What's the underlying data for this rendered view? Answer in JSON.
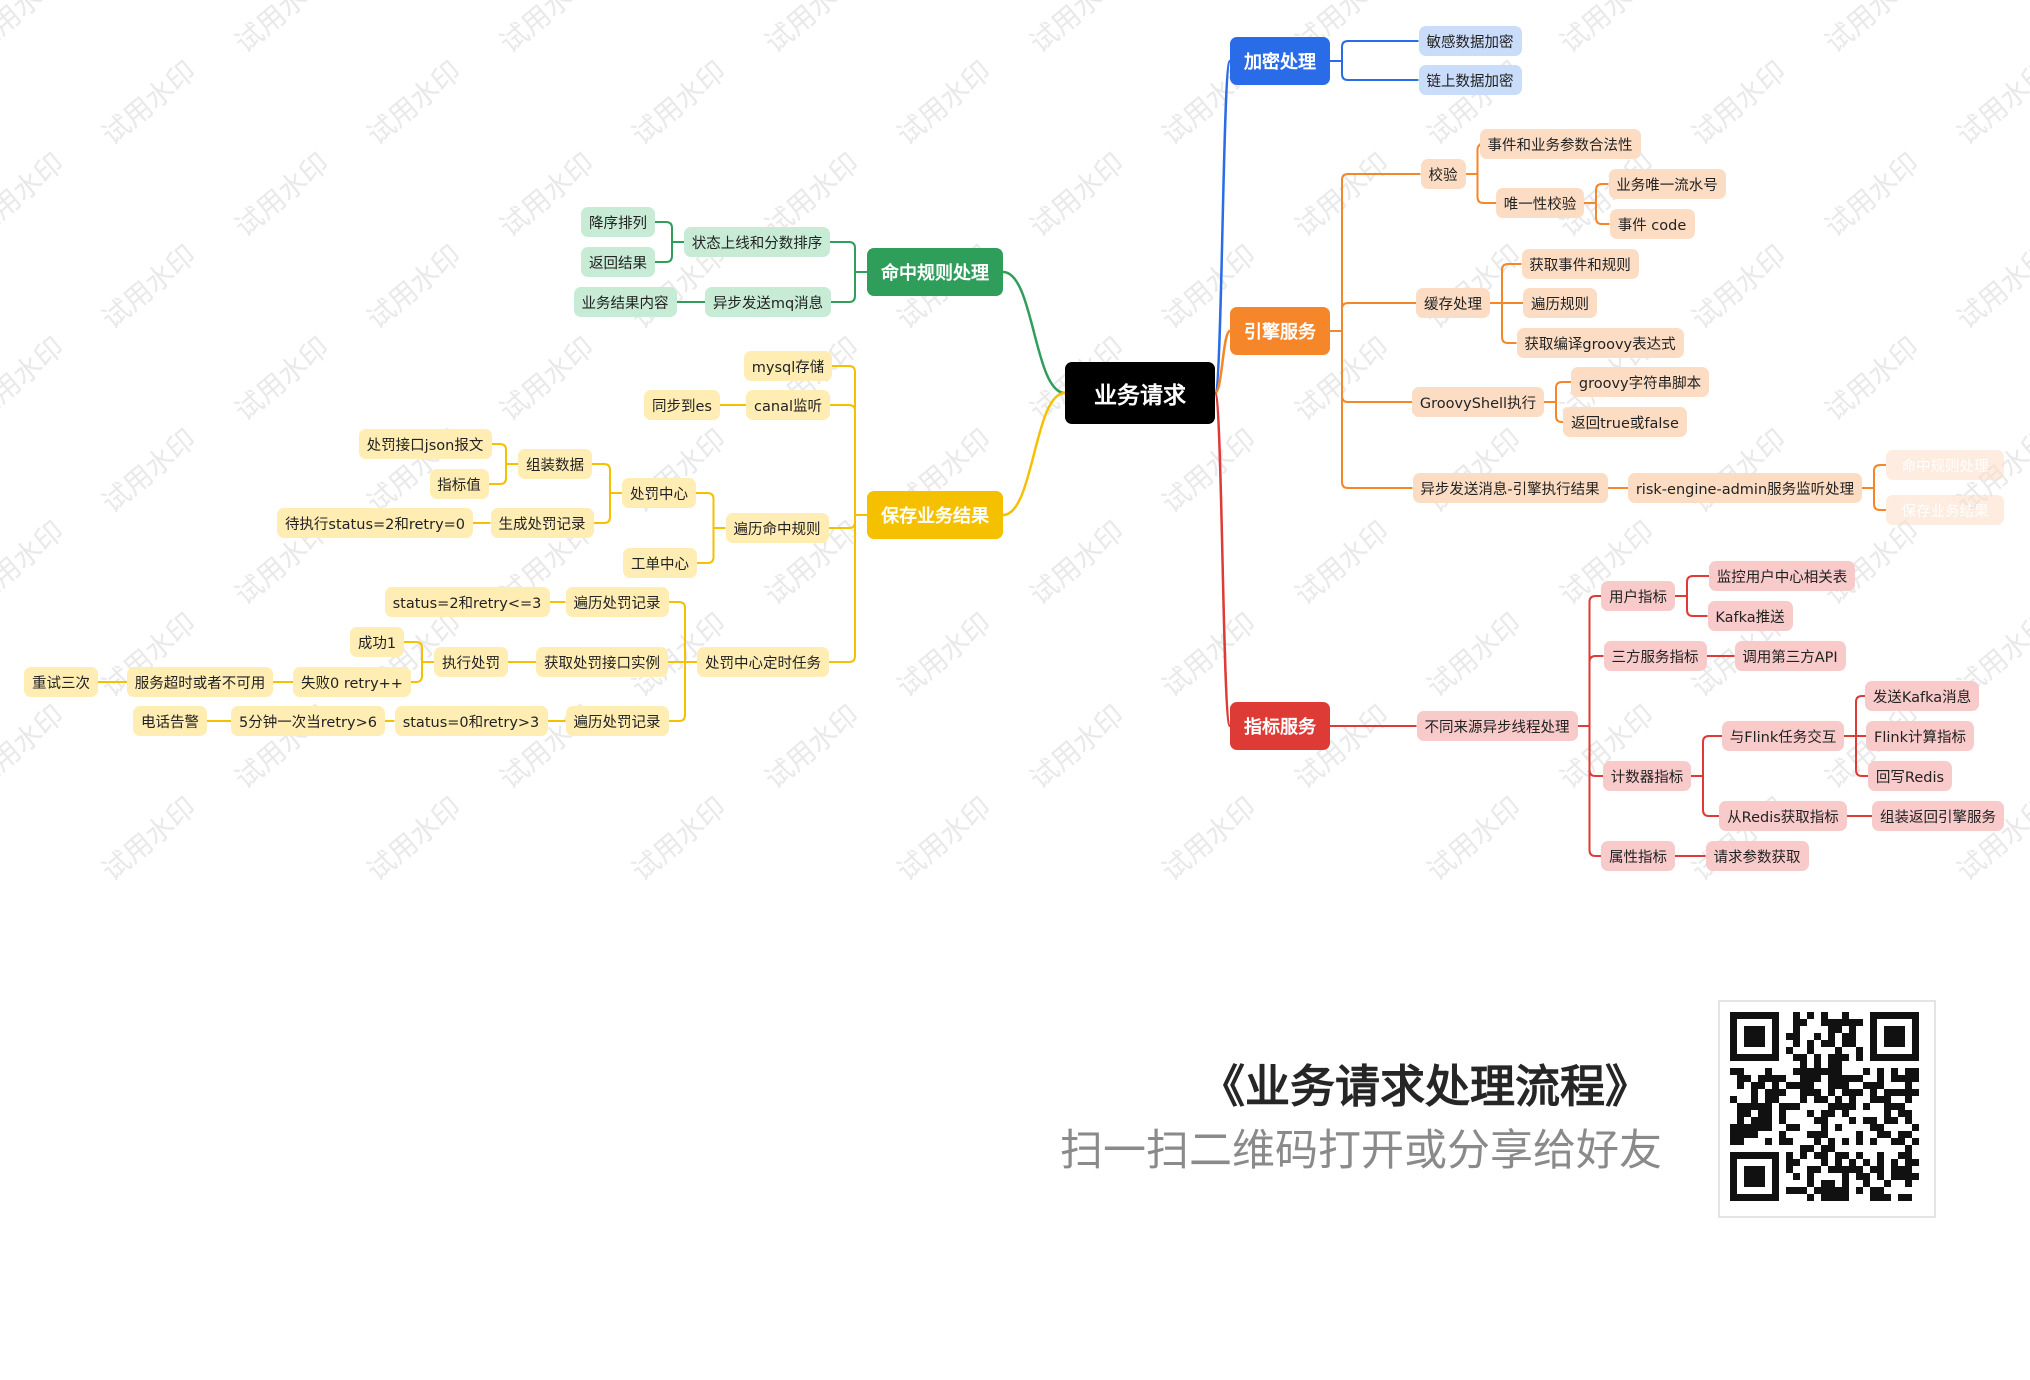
{
  "mindmap": {
    "root": {
      "label": "业务请求"
    },
    "branches": [
      {
        "id": "enc",
        "label": "加密处理",
        "color": "#2A6BE8",
        "light": "#C9DCF9",
        "children": [
          {
            "label": "敏感数据加密"
          },
          {
            "label": "链上数据加密"
          }
        ]
      },
      {
        "id": "eng",
        "label": "引擎服务",
        "color": "#F5862A",
        "light": "#FCDDC4",
        "children": [
          {
            "label": "校验",
            "children": [
              {
                "label": "事件和业务参数合法性"
              },
              {
                "label": "唯一性校验",
                "children": [
                  {
                    "label": "业务唯一流水号"
                  },
                  {
                    "label": "事件 code"
                  }
                ]
              }
            ]
          },
          {
            "label": "缓存处理",
            "children": [
              {
                "label": "获取事件和规则"
              },
              {
                "label": "遍历规则"
              },
              {
                "label": "获取编译groovy表达式"
              }
            ]
          },
          {
            "label": "GroovyShell执行",
            "children": [
              {
                "label": "groovy字符串脚本"
              },
              {
                "label": "返回true或false"
              }
            ]
          },
          {
            "label": "异步发送消息-引擎执行结果",
            "children": [
              {
                "label": "risk-engine-admin服务监听处理",
                "children": [
                  {
                    "label": "命中规则处理"
                  },
                  {
                    "label": "保存业务结果"
                  }
                ]
              }
            ]
          }
        ]
      },
      {
        "id": "idx",
        "label": "指标服务",
        "color": "#DE3A36",
        "light": "#F8CACA",
        "children": [
          {
            "label": "不同来源异步线程处理",
            "children": [
              {
                "label": "用户指标",
                "children": [
                  {
                    "label": "监控用户中心相关表"
                  },
                  {
                    "label": "Kafka推送"
                  }
                ]
              },
              {
                "label": "三方服务指标",
                "children": [
                  {
                    "label": "调用第三方API"
                  }
                ]
              },
              {
                "label": "计数器指标",
                "children": [
                  {
                    "label": "与Flink任务交互",
                    "children": [
                      {
                        "label": "发送Kafka消息"
                      },
                      {
                        "label": "Flink计算指标"
                      },
                      {
                        "label": "回写Redis"
                      }
                    ]
                  },
                  {
                    "label": "从Redis获取指标",
                    "children": [
                      {
                        "label": "组装返回引擎服务"
                      }
                    ]
                  }
                ]
              },
              {
                "label": "属性指标",
                "children": [
                  {
                    "label": "请求参数获取"
                  }
                ]
              }
            ]
          }
        ]
      },
      {
        "id": "hit",
        "label": "命中规则处理",
        "color": "#2F9E5B",
        "light": "#C8EBD5",
        "children": [
          {
            "label": "状态上线和分数排序",
            "children": [
              {
                "label": "降序排列"
              },
              {
                "label": "返回结果"
              }
            ]
          },
          {
            "label": "异步发送mq消息",
            "children": [
              {
                "label": "业务结果内容"
              }
            ]
          }
        ]
      },
      {
        "id": "save",
        "label": "保存业务结果",
        "color": "#F5C000",
        "light": "#FFEDB3",
        "children": [
          {
            "label": "mysql存储"
          },
          {
            "label": "canal监听",
            "children": [
              {
                "label": "同步到es"
              }
            ]
          },
          {
            "label": "遍历命中规则",
            "children": [
              {
                "label": "处罚中心",
                "children": [
                  {
                    "label": "组装数据",
                    "children": [
                      {
                        "label": "处罚接口json报文"
                      },
                      {
                        "label": "指标值"
                      }
                    ]
                  },
                  {
                    "label": "生成处罚记录",
                    "children": [
                      {
                        "label": "待执行status=2和retry=0"
                      }
                    ]
                  }
                ]
              },
              {
                "label": "工单中心"
              }
            ]
          },
          {
            "label": "处罚中心定时任务",
            "children": [
              {
                "label": "遍历处罚记录",
                "children": [
                  {
                    "label": "status=2和retry<=3"
                  }
                ]
              },
              {
                "label": "获取处罚接口实例",
                "children": [
                  {
                    "label": "执行处罚",
                    "children": [
                      {
                        "label": "成功1"
                      },
                      {
                        "label": "失败0 retry++",
                        "children": [
                          {
                            "label": "服务超时或者不可用",
                            "children": [
                              {
                                "label": "重试三次"
                              }
                            ]
                          }
                        ]
                      }
                    ]
                  }
                ]
              },
              {
                "label": "遍历处罚记录",
                "children": [
                  {
                    "label": "status=0和retry>3",
                    "children": [
                      {
                        "label": "5分钟一次当retry>6",
                        "children": [
                          {
                            "label": "电话告警"
                          }
                        ]
                      }
                    ]
                  }
                ]
              }
            ]
          }
        ]
      }
    ]
  },
  "watermark": "试用水印",
  "footer": {
    "title": "《业务请求处理流程》",
    "subtitle": "扫一扫二维码打开或分享给好友"
  },
  "qr_code": "qr-code-icon"
}
